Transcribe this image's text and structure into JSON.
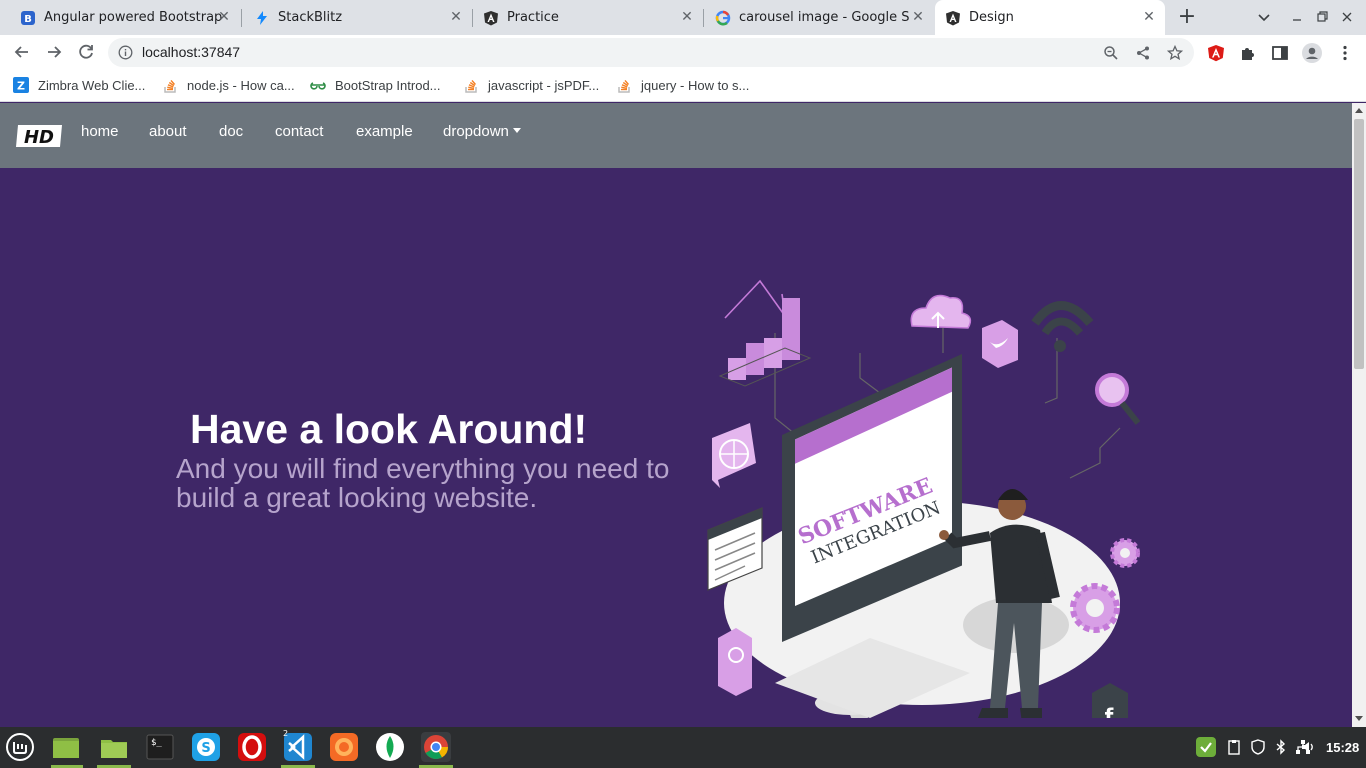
{
  "browser": {
    "tabs": [
      {
        "title": "Angular powered Bootstrap",
        "icon": "bootstrap-icon"
      },
      {
        "title": "StackBlitz",
        "icon": "lightning-icon"
      },
      {
        "title": "Practice",
        "icon": "angular-icon"
      },
      {
        "title": "carousel image - Google Sea",
        "icon": "google-icon"
      },
      {
        "title": "Design",
        "icon": "angular-icon",
        "active": true
      }
    ],
    "close_glyph": "✕",
    "new_tab_glyph": "+",
    "url": "localhost:37847",
    "bookmarks": [
      {
        "label": "Zimbra Web Clie...",
        "icon": "zimbra-icon"
      },
      {
        "label": "node.js - How ca...",
        "icon": "stackoverflow-icon"
      },
      {
        "label": "BootStrap Introd...",
        "icon": "geeksforgeeks-icon"
      },
      {
        "label": "javascript - jsPDF...",
        "icon": "stackoverflow-icon"
      },
      {
        "label": "jquery - How to s...",
        "icon": "stackoverflow-icon"
      }
    ]
  },
  "site": {
    "brand": "HD",
    "nav": {
      "home": "home",
      "about": "about",
      "doc": "doc",
      "contact": "contact",
      "example": "example",
      "dropdown": "dropdown"
    },
    "hero": {
      "heading_plain": "Have a look ",
      "heading_bold": "Around!",
      "subheading": "And you will find everything you need to build a great looking website."
    },
    "illustration": {
      "screen_line1": "SOFTWARE",
      "screen_line2": "INTEGRATION"
    }
  },
  "taskbar": {
    "apps": [
      "mint-menu-icon",
      "files-icon",
      "folder-icon",
      "terminal-icon",
      "skype-icon",
      "opera-icon",
      "vscode-icon",
      "firefox-icon",
      "mongodb-icon",
      "chrome-icon"
    ],
    "vscode_badge": "2",
    "clock": "15:28"
  },
  "colors": {
    "hero_bg": "#3f2767",
    "navbar_bg": "#6c757d",
    "accent_purple": "#b66fce"
  }
}
